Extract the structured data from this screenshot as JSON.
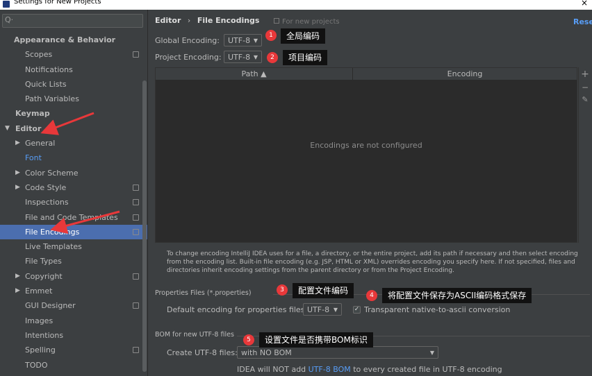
{
  "window": {
    "title": "Settings for New Projects",
    "close_glyph": "×"
  },
  "search": {
    "placeholder": "Q·"
  },
  "tree": [
    {
      "label": "Appearance & Behavior",
      "level": 0,
      "expandable": false,
      "bold": true
    },
    {
      "label": "Scopes",
      "level": 1,
      "proj": true
    },
    {
      "label": "Notifications",
      "level": 1
    },
    {
      "label": "Quick Lists",
      "level": 1
    },
    {
      "label": "Path Variables",
      "level": 1
    },
    {
      "label": "Keymap",
      "level": 0,
      "bold": true
    },
    {
      "label": "Editor",
      "level": 0,
      "bold": true,
      "expanded": true
    },
    {
      "label": "General",
      "level": 1,
      "expandable": true
    },
    {
      "label": "Font",
      "level": 1,
      "accent": true
    },
    {
      "label": "Color Scheme",
      "level": 1,
      "expandable": true
    },
    {
      "label": "Code Style",
      "level": 1,
      "expandable": true,
      "proj": true
    },
    {
      "label": "Inspections",
      "level": 1,
      "proj": true
    },
    {
      "label": "File and Code Templates",
      "level": 1,
      "proj": true
    },
    {
      "label": "File Encodings",
      "level": 1,
      "proj": true,
      "selected": true
    },
    {
      "label": "Live Templates",
      "level": 1
    },
    {
      "label": "File Types",
      "level": 1
    },
    {
      "label": "Copyright",
      "level": 1,
      "expandable": true,
      "proj": true
    },
    {
      "label": "Emmet",
      "level": 1,
      "expandable": true
    },
    {
      "label": "GUI Designer",
      "level": 1,
      "proj": true
    },
    {
      "label": "Images",
      "level": 1
    },
    {
      "label": "Intentions",
      "level": 1
    },
    {
      "label": "Spelling",
      "level": 1,
      "proj": true
    },
    {
      "label": "TODO",
      "level": 1
    }
  ],
  "breadcrumb": {
    "parent": "Editor",
    "separator": "›",
    "current": "File Encodings"
  },
  "for_new_projects": "For new projects",
  "reset_label": "Reset",
  "global_encoding": {
    "label": "Global Encoding:",
    "value": "UTF-8"
  },
  "project_encoding": {
    "label": "Project Encoding:",
    "value": "UTF-8"
  },
  "table": {
    "col_path": "Path ▲",
    "col_encoding": "Encoding",
    "empty_text": "Encodings are not configured"
  },
  "side_tools": {
    "add": "+",
    "remove": "−",
    "edit": "✎"
  },
  "description": "To change encoding IntelliJ IDEA uses for a file, a directory, or the entire project, add its path if necessary and then select encoding from the encoding list. Built-in file encoding (e.g. JSP, HTML or XML) overrides encoding you specify here. If not specified, files and directories inherit encoding settings from the parent directory or from the Project Encoding.",
  "properties": {
    "section_title": "Properties Files (*.properties)",
    "default_label": "Default encoding for properties files:",
    "default_value": "UTF-8",
    "transparent_label": "Transparent native-to-ascii conversion",
    "transparent_checked": true
  },
  "bom": {
    "section_title": "BOM for new UTF-8 files",
    "create_label": "Create UTF-8 files:",
    "create_value": "with NO BOM",
    "note_prefix": "IDEA will NOT add ",
    "note_link": "UTF-8 BOM",
    "note_suffix": " to every created file in UTF-8 encoding"
  },
  "annotations": [
    {
      "num": "1",
      "text": "全局编码"
    },
    {
      "num": "2",
      "text": "项目编码"
    },
    {
      "num": "3",
      "text": "配置文件编码"
    },
    {
      "num": "4",
      "text": "将配置文件保存为ASCII编码格式保存"
    },
    {
      "num": "5",
      "text": "设置文件是否携带BOM标识"
    }
  ],
  "colors": {
    "accent": "#589df6",
    "selected": "#4b6eaf",
    "badge": "#e8383a",
    "arrow": "#e8383a",
    "panel": "#3c3f41",
    "table": "#2b2b2b"
  }
}
